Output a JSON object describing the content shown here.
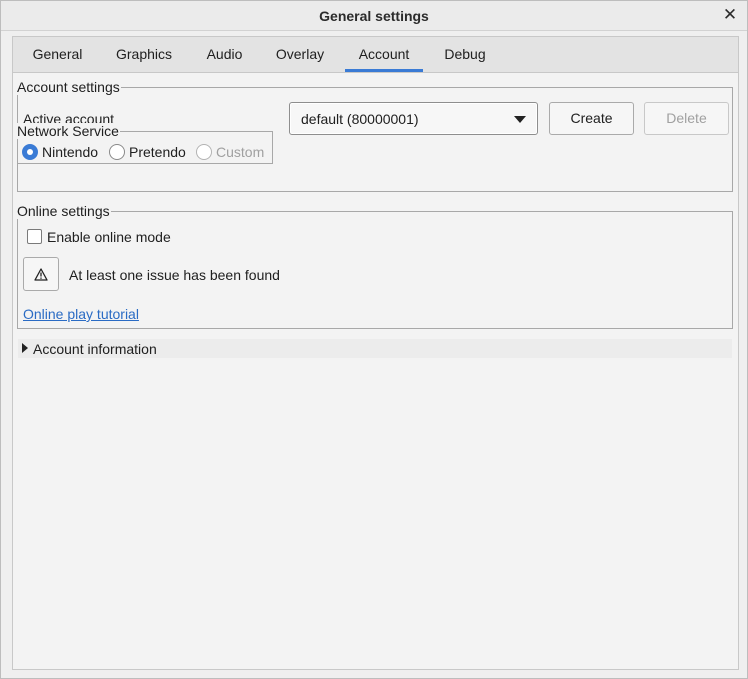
{
  "window": {
    "title": "General settings",
    "close_glyph": "✕"
  },
  "tabs": [
    {
      "label": "General",
      "active": false
    },
    {
      "label": "Graphics",
      "active": false
    },
    {
      "label": "Audio",
      "active": false
    },
    {
      "label": "Overlay",
      "active": false
    },
    {
      "label": "Account",
      "active": true
    },
    {
      "label": "Debug",
      "active": false
    }
  ],
  "account_settings": {
    "group_label": "Account settings",
    "active_account_label": "Active account",
    "active_account_value": "default (80000001)",
    "create_label": "Create",
    "delete_label": "Delete",
    "network_service": {
      "group_label": "Network Service",
      "options": [
        {
          "label": "Nintendo",
          "checked": true,
          "enabled": true
        },
        {
          "label": "Pretendo",
          "checked": false,
          "enabled": true
        },
        {
          "label": "Custom",
          "checked": false,
          "enabled": false
        }
      ]
    }
  },
  "online_settings": {
    "group_label": "Online settings",
    "enable_online_label": "Enable online mode",
    "enable_online_checked": false,
    "issue_icon": "warning-icon",
    "issue_text": "At least one issue has been found",
    "tutorial_link": "Online play tutorial"
  },
  "account_information": {
    "label": "Account information",
    "expanded": false
  },
  "colors": {
    "accent": "#3a7bd5",
    "link": "#2a6bc4"
  }
}
